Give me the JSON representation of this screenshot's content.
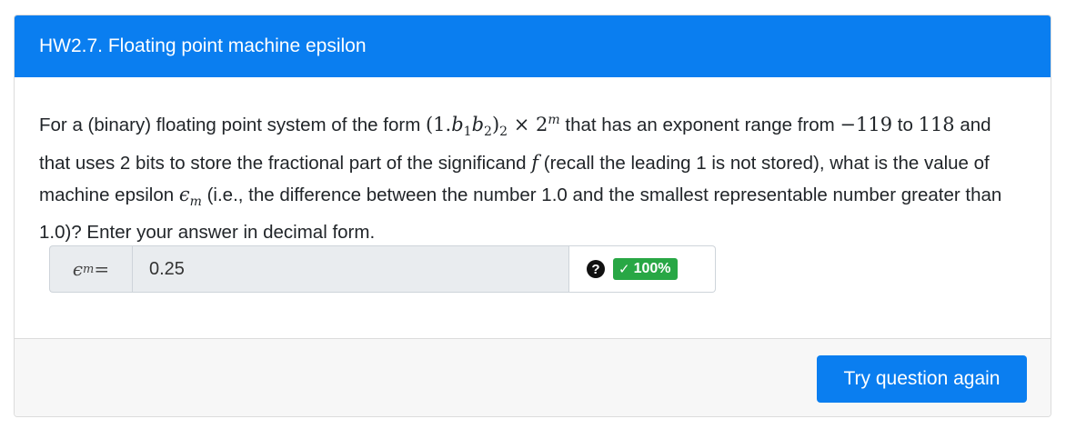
{
  "header": {
    "title": "HW2.7. Floating point machine epsilon"
  },
  "question": {
    "t1": "For a (binary) floating point system of the form ",
    "m_form_a": "(1.",
    "m_b": "b",
    "m_sub1": "1",
    "m_sub2": "2",
    "m_form_b": ")",
    "m_base_sub": "2",
    "m_times": " × 2",
    "m_exp": "m",
    "t2": " that has an exponent range from ",
    "m_low": "−119",
    "t3": " to ",
    "m_high": "118",
    "t4": " and that uses 2 bits to store the fractional part of the significand ",
    "m_f": "f",
    "t5": " (recall the leading 1 is not stored), what is the value of machine epsilon ",
    "m_eps": "ϵ",
    "m_eps_sub": "m",
    "t6": " (i.e., the difference between the number 1.0 and the smallest representable number greater than 1.0)? Enter your answer in decimal form."
  },
  "answer": {
    "label_symbol": "ϵ",
    "label_sub": "m",
    "label_eq": " =",
    "value": "0.25",
    "help_icon": "question-circle-icon",
    "score_icon": "check-icon",
    "score_check": "✓",
    "score_text": "100%",
    "score_color": "#28a745"
  },
  "footer": {
    "try_again_label": "Try question again"
  },
  "colors": {
    "accent": "#0a7ef0",
    "success": "#28a745"
  }
}
